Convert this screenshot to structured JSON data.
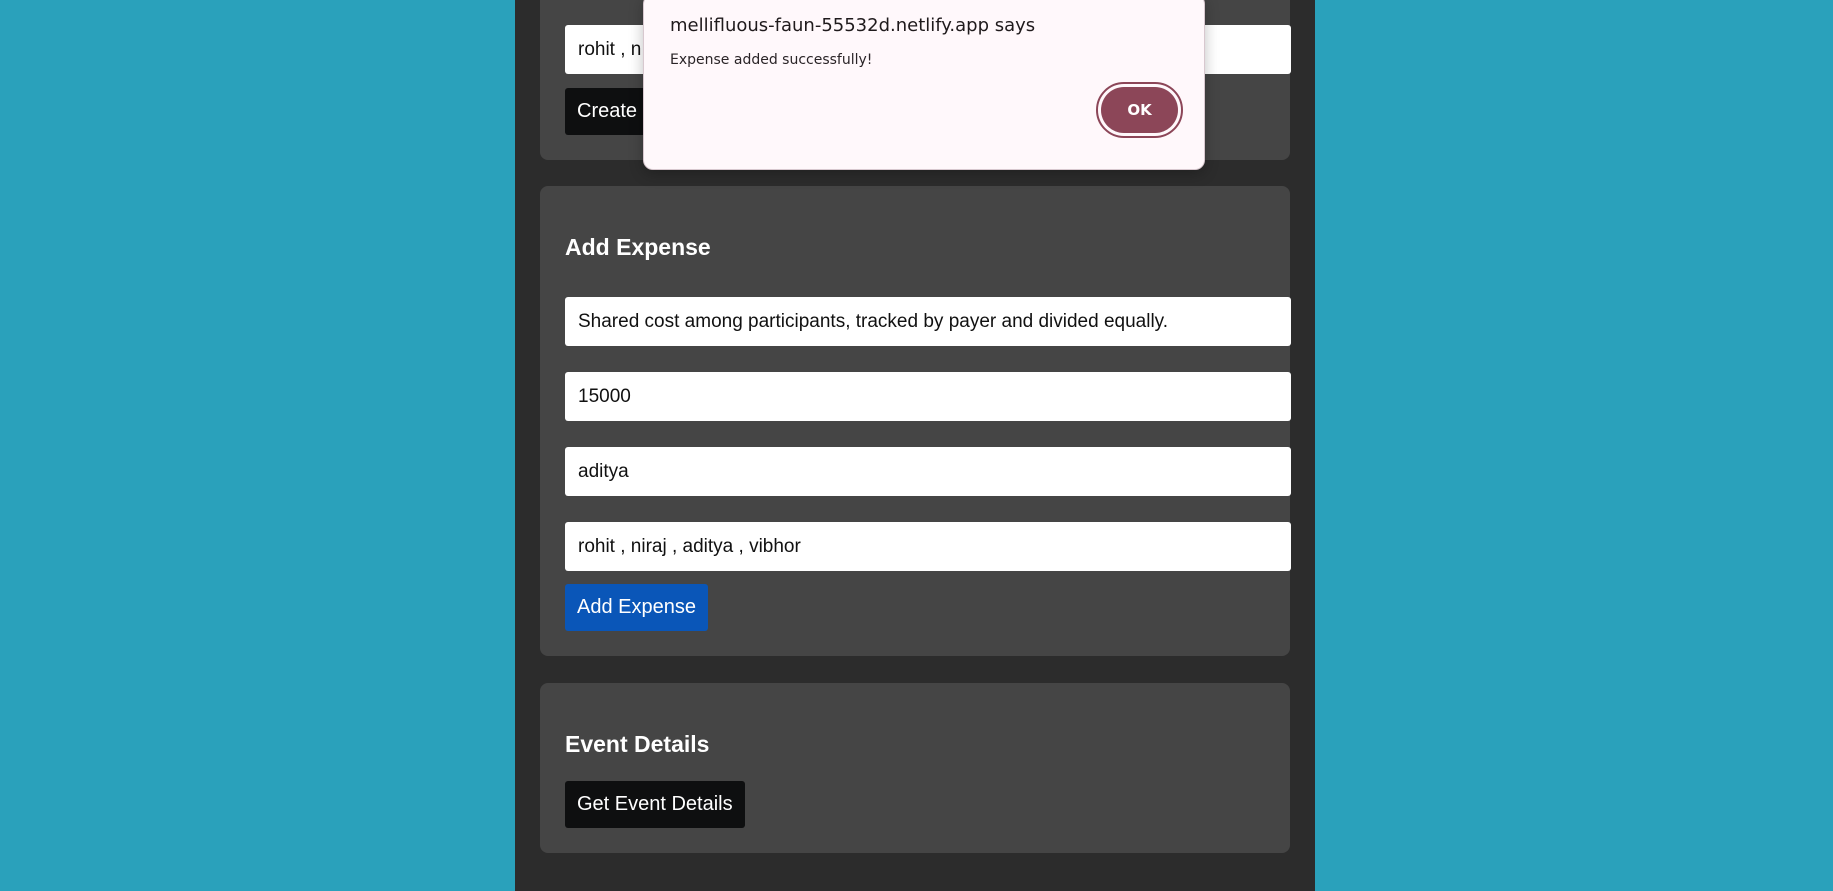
{
  "colors": {
    "background": "#2aa1bb",
    "page": "#2c2c2c",
    "card": "#454545",
    "dark_button": "#0e0f10",
    "primary_button": "#0a56b8",
    "dialog_accent": "#8c4658"
  },
  "create_event": {
    "participants_value": "rohit , n",
    "create_button_label": "Create"
  },
  "add_expense": {
    "title": "Add Expense",
    "description_value": "Shared cost among participants, tracked by payer and divided equally.",
    "amount_value": "15000",
    "payer_value": "aditya",
    "split_among_value": "rohit , niraj , aditya , vibhor",
    "submit_label": "Add Expense"
  },
  "event_details": {
    "title": "Event Details",
    "button_label": "Get Event Details"
  },
  "alert": {
    "title": "mellifluous-faun-55532d.netlify.app says",
    "message": "Expense added successfully!",
    "ok_label": "OK"
  }
}
